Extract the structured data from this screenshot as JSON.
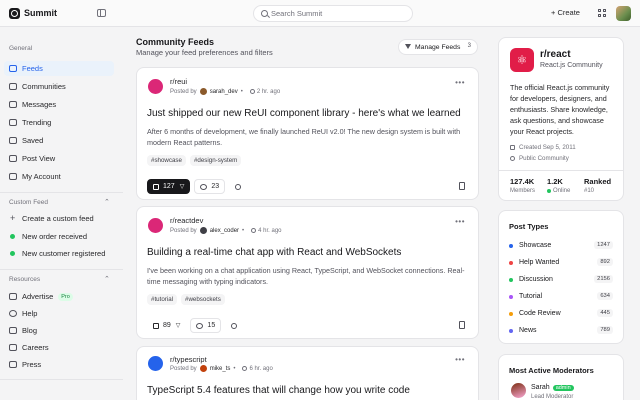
{
  "header": {
    "brand": "Summit",
    "search_placeholder": "Search Summit",
    "create_label": "Create"
  },
  "sidebar": {
    "general_title": "General",
    "general_items": [
      {
        "label": "Feeds",
        "icon": "home-icon",
        "active": true
      },
      {
        "label": "Communities",
        "icon": "users-icon"
      },
      {
        "label": "Messages",
        "icon": "message-icon"
      },
      {
        "label": "Trending",
        "icon": "trending-icon"
      },
      {
        "label": "Saved",
        "icon": "bookmark-icon"
      },
      {
        "label": "Post View",
        "icon": "file-icon"
      },
      {
        "label": "My Account",
        "icon": "user-icon"
      }
    ],
    "custom_title": "Custom Feed",
    "custom_items": [
      {
        "label": "Create a custom feed",
        "icon": "plus-icon"
      },
      {
        "label": "New order received",
        "icon": "dot-icon"
      },
      {
        "label": "New customer registered",
        "icon": "dot-icon"
      }
    ],
    "resources_title": "Resources",
    "resources_items": [
      {
        "label": "Advertise",
        "icon": "megaphone-icon",
        "badge": "Pro"
      },
      {
        "label": "Help",
        "icon": "help-icon"
      },
      {
        "label": "Blog",
        "icon": "book-icon"
      },
      {
        "label": "Careers",
        "icon": "briefcase-icon"
      },
      {
        "label": "Press",
        "icon": "newspaper-icon"
      }
    ]
  },
  "main": {
    "title": "Community Feeds",
    "subtitle": "Manage your feed preferences and filters",
    "manage_label": "Manage Feeds",
    "manage_count": "3",
    "posts": [
      {
        "community": "r/reui",
        "posted_by": "Posted by",
        "author": "sarah_dev",
        "time": "2 hr. ago",
        "title": "Just shipped our new ReUI component library - here's what we learned",
        "body": "After 6 months of development, we finally launched ReUI v2.0! The new design system is built with modern React patterns.",
        "tags": [
          "#showcase",
          "#design-system"
        ],
        "likes": "127",
        "comments": "23",
        "liked": true,
        "icon_color": "#db2777"
      },
      {
        "community": "r/reactdev",
        "posted_by": "Posted by",
        "author": "alex_coder",
        "time": "4 hr. ago",
        "title": "Building a real-time chat app with React and WebSockets",
        "body": "I've been working on a chat application using React, TypeScript, and WebSocket connections. Real-time messaging with typing indicators.",
        "tags": [
          "#tutorial",
          "#websockets"
        ],
        "likes": "89",
        "comments": "15",
        "liked": false,
        "icon_color": "#db2777"
      },
      {
        "community": "r/typescript",
        "posted_by": "Posted by",
        "author": "mike_ts",
        "time": "6 hr. ago",
        "title": "TypeScript 5.4 features that will change how you write code",
        "icon_color": "#2563eb"
      }
    ]
  },
  "community": {
    "name": "r/react",
    "sub": "React.js Community",
    "description": "The official React.js community for developers, designers, and enthusiasts. Share knowledge, ask questions, and showcase your React projects.",
    "created": "Created Sep 5, 2011",
    "visibility": "Public Community",
    "stats": [
      {
        "value": "127.4K",
        "label": "Members"
      },
      {
        "value": "1.2K",
        "label": "Online"
      },
      {
        "value": "Ranked",
        "label": "#10"
      }
    ]
  },
  "post_types": {
    "title": "Post Types",
    "items": [
      {
        "label": "Showcase",
        "count": "1247",
        "color": "#2563eb"
      },
      {
        "label": "Help Wanted",
        "count": "892",
        "color": "#ef4444"
      },
      {
        "label": "Discussion",
        "count": "2156",
        "color": "#22c55e"
      },
      {
        "label": "Tutorial",
        "count": "634",
        "color": "#a855f7"
      },
      {
        "label": "Code Review",
        "count": "445",
        "color": "#f59e0b"
      },
      {
        "label": "News",
        "count": "789",
        "color": "#6366f1"
      }
    ]
  },
  "moderators": {
    "title": "Most Active Moderators",
    "items": [
      {
        "name": "Sarah",
        "badge": "admin",
        "role": "Lead Moderator"
      }
    ]
  }
}
